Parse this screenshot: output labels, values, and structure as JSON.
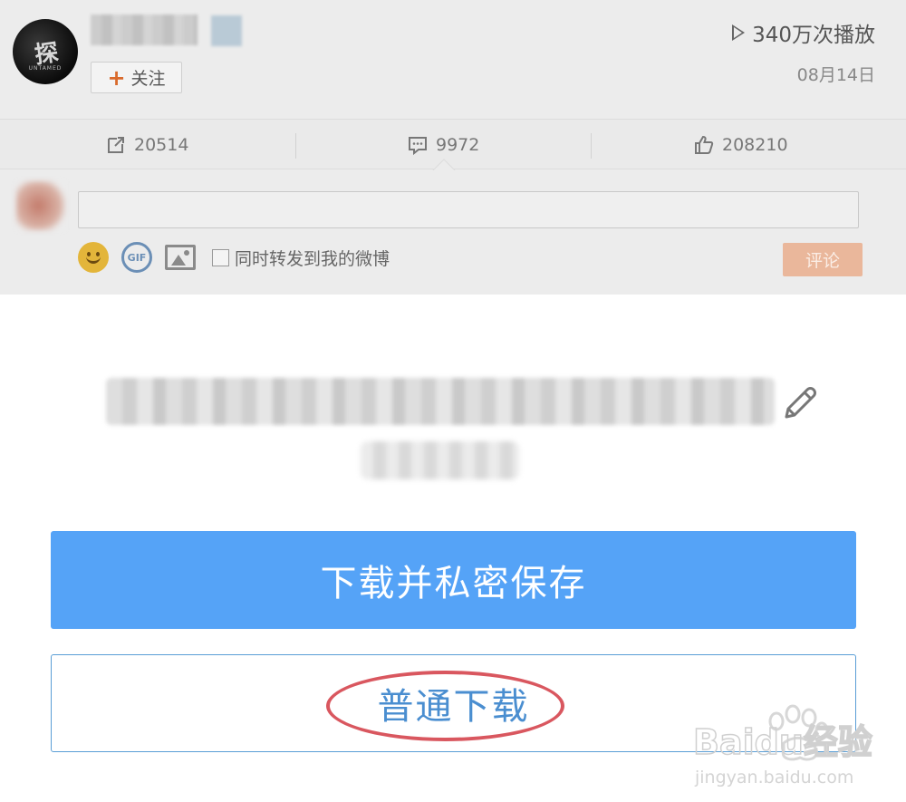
{
  "post": {
    "play_count": "340万次播放",
    "date": "08月14日",
    "follow_label": "关注",
    "avatar_text": "探",
    "avatar_subtext": "UNTAMED"
  },
  "actions": {
    "repost_count": "20514",
    "comment_count": "9972",
    "like_count": "208210"
  },
  "comment_box": {
    "repost_option": "同时转发到我的微博",
    "submit_label": "评论",
    "gif_label": "GIF"
  },
  "download_sheet": {
    "private_save_label": "下载并私密保存",
    "normal_download_label": "普通下载"
  },
  "watermark": {
    "brand": "Baidu经验",
    "url": "jingyan.baidu.com"
  },
  "colors": {
    "primary_button": "#55a3f7",
    "secondary_border": "#5a9ed6",
    "highlight": "#d9575f",
    "follow_plus": "#d96a2c",
    "submit_disabled": "#eab79b"
  },
  "icons": [
    "avatar",
    "plus-icon",
    "play-icon",
    "repost-icon",
    "comment-icon",
    "like-icon",
    "emoji-icon",
    "gif-icon",
    "image-icon",
    "edit-icon"
  ]
}
